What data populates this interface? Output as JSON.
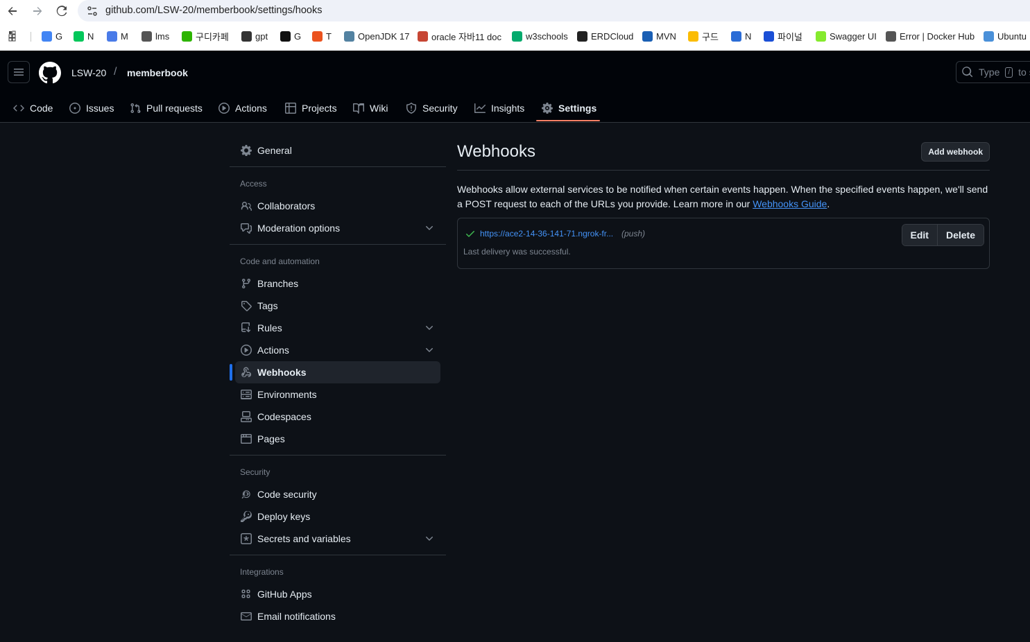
{
  "browser": {
    "url": "github.com/LSW-20/memberbook/settings/hooks",
    "bookmarks": [
      {
        "label": "G",
        "icon": "google-icon",
        "color": "#4285f4"
      },
      {
        "label": "N",
        "icon": "naver-icon",
        "color": "#03c75a"
      },
      {
        "label": "M",
        "icon": "cube-icon",
        "color": "#4a7be8"
      },
      {
        "label": "lms",
        "icon": "globe-icon",
        "color": "#555555"
      },
      {
        "label": "구디카페",
        "icon": "cafe-icon",
        "color": "#2db400"
      },
      {
        "label": "gpt",
        "icon": "openai-icon",
        "color": "#333333"
      },
      {
        "label": "G",
        "icon": "github-icon",
        "color": "#111111"
      },
      {
        "label": "T",
        "icon": "tistory-icon",
        "color": "#eb531f"
      },
      {
        "label": "OpenJDK 17",
        "icon": "java-icon",
        "color": "#5382a1"
      },
      {
        "label": "oracle 자바11 doc",
        "icon": "oracle-icon",
        "color": "#c74634"
      },
      {
        "label": "w3schools",
        "icon": "w3schools-icon",
        "color": "#04aa6d"
      },
      {
        "label": "ERDCloud",
        "icon": "erd-icon",
        "color": "#222222"
      },
      {
        "label": "MVN",
        "icon": "mvn-icon",
        "color": "#1a5fb4"
      },
      {
        "label": "구드",
        "icon": "drive-icon",
        "color": "#fbbc04"
      },
      {
        "label": "N",
        "icon": "two-icon",
        "color": "#2b6cd6"
      },
      {
        "label": "파이널",
        "icon": "search-q-icon",
        "color": "#1a4fd6"
      },
      {
        "label": "Swagger UI",
        "icon": "swagger-icon",
        "color": "#85ea2d"
      },
      {
        "label": "Error | Docker Hub",
        "icon": "docker-icon",
        "color": "#555555"
      },
      {
        "label": "Ubuntu",
        "icon": "ubuntu-icon",
        "color": "#4a90d9"
      }
    ]
  },
  "header": {
    "owner": "LSW-20",
    "separator": "/",
    "repo": "memberbook",
    "search_placeholder": "Type",
    "search_key": "/",
    "search_suffix": "to s"
  },
  "tabs": [
    {
      "label": "Code",
      "icon": "code-icon"
    },
    {
      "label": "Issues",
      "icon": "issue-icon"
    },
    {
      "label": "Pull requests",
      "icon": "pull-request-icon"
    },
    {
      "label": "Actions",
      "icon": "play-icon"
    },
    {
      "label": "Projects",
      "icon": "table-icon"
    },
    {
      "label": "Wiki",
      "icon": "book-icon"
    },
    {
      "label": "Security",
      "icon": "shield-icon"
    },
    {
      "label": "Insights",
      "icon": "graph-icon"
    },
    {
      "label": "Settings",
      "icon": "gear-icon",
      "active": true
    }
  ],
  "sidebar": {
    "general": "General",
    "access_heading": "Access",
    "collaborators": "Collaborators",
    "moderation": "Moderation options",
    "code_heading": "Code and automation",
    "branches": "Branches",
    "tags": "Tags",
    "rules": "Rules",
    "actions": "Actions",
    "webhooks": "Webhooks",
    "environments": "Environments",
    "codespaces": "Codespaces",
    "pages": "Pages",
    "security_heading": "Security",
    "code_security": "Code security",
    "deploy_keys": "Deploy keys",
    "secrets": "Secrets and variables",
    "integrations_heading": "Integrations",
    "github_apps": "GitHub Apps",
    "email_notifications": "Email notifications"
  },
  "main": {
    "title": "Webhooks",
    "add_button": "Add webhook",
    "description": "Webhooks allow external services to be notified when certain events happen. When the specified events happen, we'll send a POST request to each of the URLs you provide. Learn more in our ",
    "guide_link": "Webhooks Guide",
    "description_end": ".",
    "hook": {
      "url": "https://ace2-14-36-141-71.ngrok-fr...",
      "events": "(push)",
      "status": "Last delivery was successful.",
      "edit": "Edit",
      "delete": "Delete"
    }
  },
  "colors": {
    "accent_underline": "#f78166",
    "link": "#4493f8",
    "success": "#3fb950",
    "active_bar": "#1f6feb"
  }
}
